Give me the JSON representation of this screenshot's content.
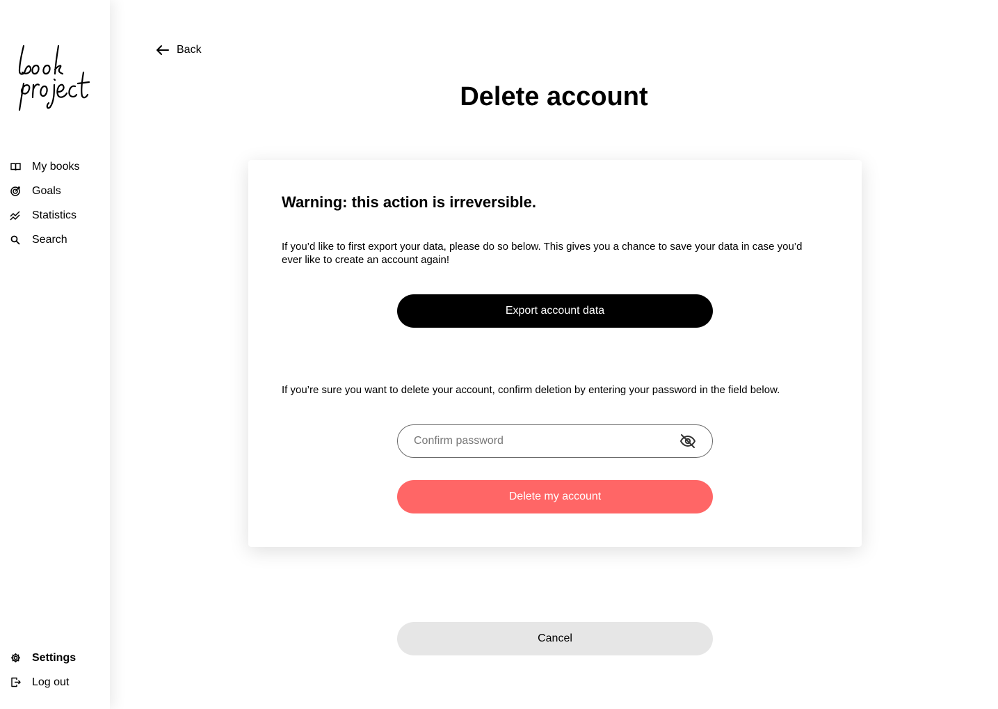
{
  "app": {
    "logo_text": "book project"
  },
  "sidebar": {
    "items": [
      {
        "label": "My books",
        "icon": "book-open-icon"
      },
      {
        "label": "Goals",
        "icon": "target-icon"
      },
      {
        "label": "Statistics",
        "icon": "chart-line-icon"
      },
      {
        "label": "Search",
        "icon": "search-icon"
      }
    ],
    "bottom_items": [
      {
        "label": "Settings",
        "icon": "gear-icon",
        "active": true
      },
      {
        "label": "Log out",
        "icon": "logout-icon"
      }
    ]
  },
  "header": {
    "back_label": "Back",
    "title": "Delete account"
  },
  "card": {
    "warning": "Warning: this action is irreversible.",
    "export_text": "If you’d like to first export your data, please do so below. This gives you a chance to save your data in case you’d ever like to create an account again!",
    "export_button": "Export account data",
    "confirm_text": "If you’re sure you want to delete your account, confirm deletion by entering your password in the field below.",
    "password_placeholder": "Confirm password",
    "password_value": "",
    "password_toggle_icon": "eye-off-icon",
    "delete_button": "Delete my account"
  },
  "footer": {
    "cancel_button": "Cancel"
  },
  "colors": {
    "delete": "#ff6666",
    "export": "#000000",
    "cancel": "#e6e6e6"
  }
}
